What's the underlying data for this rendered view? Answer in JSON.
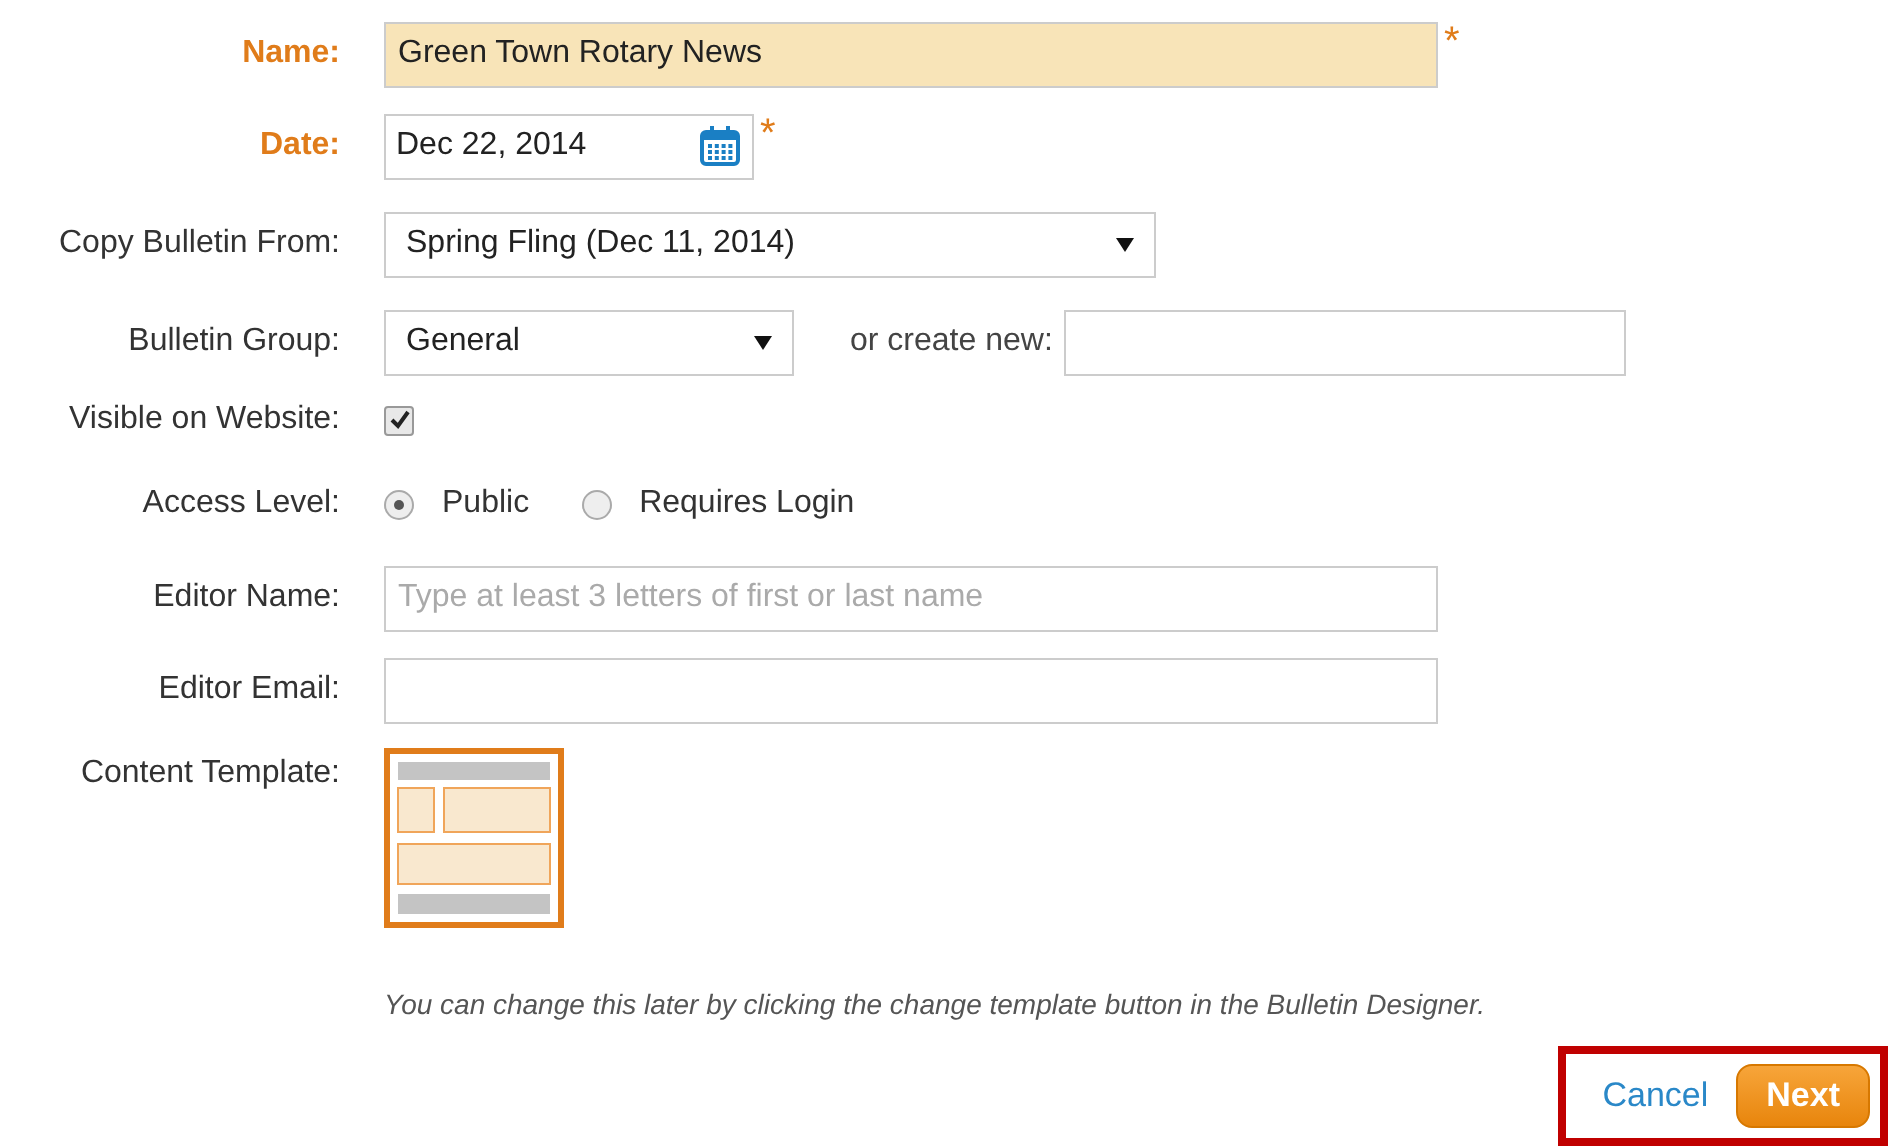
{
  "fields": [
    {
      "kind": "text",
      "label": "Name:",
      "required": true,
      "required_mark": "*",
      "value": "Green Town Rotary News",
      "highlighted": true
    },
    {
      "kind": "date",
      "label": "Date:",
      "required": true,
      "required_mark": "*",
      "value": "Dec 22, 2014"
    },
    {
      "kind": "select",
      "label": "Copy Bulletin From:",
      "required": false,
      "value": "Spring Fling (Dec 11, 2014)"
    },
    {
      "kind": "select_new",
      "label": "Bulletin Group:",
      "required": false,
      "value": "General",
      "new_label": "or create new:"
    },
    {
      "kind": "checkbox",
      "label": "Visible on Website:",
      "required": false,
      "checked": true
    },
    {
      "kind": "radio",
      "label": "Access Level:",
      "required": false,
      "options": [
        {
          "label": "Public",
          "selected": true
        },
        {
          "label": "Requires Login",
          "selected": false
        }
      ]
    },
    {
      "kind": "text",
      "label": "Editor Name:",
      "required": false,
      "placeholder": "Type at least 3 letters of first or last name",
      "highlighted": false
    },
    {
      "kind": "text",
      "label": "Editor Email:",
      "required": false,
      "highlighted": false
    },
    {
      "kind": "template",
      "label": "Content Template:",
      "required": false
    }
  ],
  "note": "You can change this later by clicking the change template button in the Bulletin Designer.",
  "actions": {
    "cancel": "Cancel",
    "next": "Next"
  }
}
